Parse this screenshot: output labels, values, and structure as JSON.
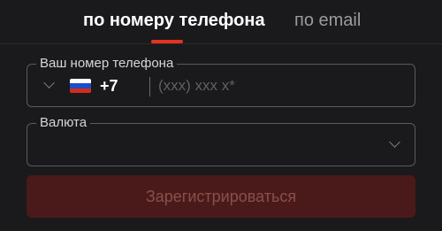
{
  "tabs": {
    "phone_label": "по номеру телефона",
    "email_label": "по email",
    "active": "phone"
  },
  "phone_field": {
    "legend": "Ваш номер телефона",
    "country_code": "+7",
    "country_flag": "ru-flag-icon",
    "placeholder": "(xxx) xxx x*",
    "value": ""
  },
  "currency_field": {
    "legend": "Валюта",
    "value": ""
  },
  "submit": {
    "label": "Зарегистрироваться",
    "disabled": true
  },
  "colors": {
    "background": "#1a1a1c",
    "accent": "#e5321f",
    "button_disabled_bg": "#4a1a1a",
    "button_disabled_text": "#8a4f4b"
  }
}
